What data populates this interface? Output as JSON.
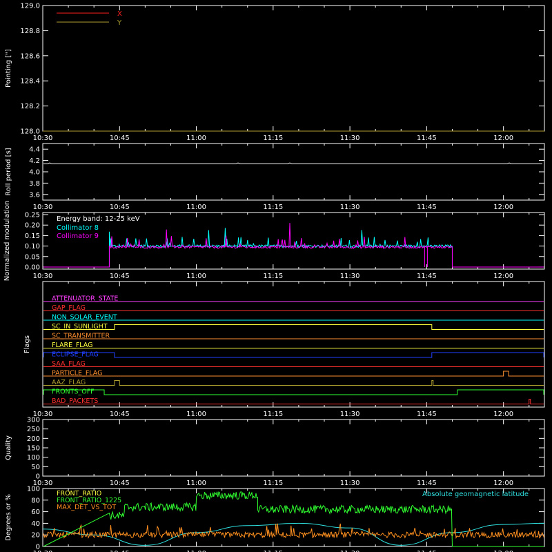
{
  "time_axis": {
    "tick_labels": [
      "10:30",
      "10:45",
      "11:00",
      "11:15",
      "11:30",
      "11:45",
      "12:00"
    ],
    "start_minutes": 630,
    "end_minutes": 728
  },
  "chart_data": [
    {
      "id": "pointing",
      "type": "line",
      "ylabel": "Pointing [\"]",
      "ylim": [
        128.0,
        129.0
      ],
      "y_ticks": [
        128.0,
        128.2,
        128.4,
        128.6,
        128.8,
        129.0
      ],
      "y_tick_labels": [
        "128.0",
        "128.2",
        "128.4",
        "128.6",
        "128.8",
        "129.0"
      ],
      "legend": [
        {
          "name": "X",
          "color": "#ff2020"
        },
        {
          "name": "Y",
          "color": "#b0a030"
        }
      ],
      "series": [
        {
          "name": "X",
          "color": "#ff2020",
          "x": [
            "10:30",
            "12:08"
          ],
          "values": [
            128.0,
            128.0
          ]
        },
        {
          "name": "Y",
          "color": "#b0a030",
          "x": [
            "10:30",
            "12:08"
          ],
          "values": [
            128.0,
            128.0
          ]
        }
      ]
    },
    {
      "id": "roll_period",
      "type": "line",
      "ylabel": "Roll period [s]",
      "ylim": [
        3.5,
        4.5
      ],
      "y_ticks": [
        3.6,
        3.8,
        4.0,
        4.2,
        4.4
      ],
      "y_tick_labels": [
        "3.6",
        "3.8",
        "4.0",
        "4.2",
        "4.4"
      ],
      "series": [
        {
          "name": "",
          "color": "#ffffff",
          "x": [
            "10:30",
            "12:08"
          ],
          "values": [
            4.14,
            4.14
          ]
        }
      ]
    },
    {
      "id": "modulation",
      "type": "line",
      "ylabel": "Normalized modulation",
      "ylim": [
        -0.01,
        0.26
      ],
      "y_ticks": [
        0.0,
        0.05,
        0.1,
        0.15,
        0.2,
        0.25
      ],
      "y_tick_labels": [
        "0.00",
        "0.05",
        "0.10",
        "0.15",
        "0.20",
        "0.25"
      ],
      "annotation": "Energy band: 12-25 keV",
      "legend": [
        {
          "name": "Collimator 8",
          "color": "#00ffff"
        },
        {
          "name": "Collimator 9",
          "color": "#ff00ff"
        }
      ],
      "active_range": [
        "10:43",
        "11:50"
      ],
      "series": [
        {
          "name": "Collimator 8",
          "color": "#00ffff",
          "baseline": 0.1,
          "spike_max": 0.23
        },
        {
          "name": "Collimator 9",
          "color": "#ff00ff",
          "baseline": 0.095,
          "spike_max": 0.25
        }
      ]
    },
    {
      "id": "flags",
      "type": "line",
      "ylabel": "Flags",
      "flags": [
        {
          "name": "ATTENUATOR_STATE",
          "color": "#ff40ff",
          "high_ranges": []
        },
        {
          "name": "GAP_FLAG",
          "color": "#ff3030",
          "high_ranges": []
        },
        {
          "name": "NON_SOLAR_EVENT",
          "color": "#00ffff",
          "high_ranges": []
        },
        {
          "name": "SC_IN_SUNLIGHT",
          "color": "#ffff40",
          "high_ranges": [
            [
              "10:44",
              "11:46"
            ]
          ]
        },
        {
          "name": "SC_TRANSMITTER",
          "color": "#ff9030",
          "high_ranges": []
        },
        {
          "name": "FLARE_FLAG",
          "color": "#ffff40",
          "high_ranges": []
        },
        {
          "name": "ECLIPSE_FLAG",
          "color": "#2040ff",
          "high_ranges": [
            [
              "10:30",
              "10:44"
            ],
            [
              "11:46",
              "12:08"
            ]
          ]
        },
        {
          "name": "SAA_FLAG",
          "color": "#ff3030",
          "high_ranges": []
        },
        {
          "name": "PARTICLE_FLAG",
          "color": "#ff9030",
          "high_ranges": [
            [
              "12:00",
              "12:01"
            ]
          ]
        },
        {
          "name": "AAZ_FLAG",
          "color": "#b0a030",
          "high_ranges": [
            [
              "10:44",
              "10:45"
            ],
            [
              "11:46",
              "11:46"
            ]
          ]
        },
        {
          "name": "FRONTS_OFF",
          "color": "#30ff30",
          "high_ranges": [
            [
              "10:30",
              "10:42"
            ],
            [
              "11:51",
              "12:08"
            ]
          ]
        },
        {
          "name": "BAD_PACKETS",
          "color": "#ff3030",
          "high_ranges": [
            [
              "12:05",
              "12:05"
            ]
          ]
        }
      ]
    },
    {
      "id": "quality",
      "type": "line",
      "ylabel": "Quality",
      "ylim": [
        0,
        300
      ],
      "y_ticks": [
        0,
        50,
        100,
        150,
        200,
        250,
        300
      ],
      "y_tick_labels": [
        "0",
        "50",
        "100",
        "150",
        "200",
        "250",
        "300"
      ],
      "series": []
    },
    {
      "id": "ratios",
      "type": "line",
      "ylabel": "Degrees or %",
      "ylim": [
        0,
        100
      ],
      "y_ticks": [
        0,
        20,
        40,
        60,
        80,
        100
      ],
      "y_tick_labels": [
        "0",
        "20",
        "40",
        "60",
        "80",
        "100"
      ],
      "legend": [
        {
          "name": "FRONT_RATIO",
          "color": "#ffff40"
        },
        {
          "name": "FRONT_RATIO_1225",
          "color": "#30ff30"
        },
        {
          "name": "MAX_DET_VS_TOT",
          "color": "#ff9020"
        }
      ],
      "right_label": {
        "text": "Absolute geomagnetic latitude",
        "color": "#30e0e0"
      },
      "series": [
        {
          "name": "FRONT_RATIO_1225",
          "color": "#30ff30",
          "segments": [
            {
              "x": [
                "10:43",
                "10:46"
              ],
              "level": 53
            },
            {
              "x": [
                "10:46",
                "11:00"
              ],
              "level": 68
            },
            {
              "x": [
                "11:00",
                "11:12"
              ],
              "level": 88
            },
            {
              "x": [
                "11:12",
                "11:50"
              ],
              "level": 64
            }
          ]
        },
        {
          "name": "MAX_DET_VS_TOT",
          "color": "#ff9020",
          "level": 20
        },
        {
          "name": "Absolute geomagnetic latitude",
          "color": "#30e0e0",
          "x": [
            "10:30",
            "10:40",
            "10:50",
            "11:00",
            "11:10",
            "11:20",
            "11:30",
            "11:40",
            "11:50",
            "12:00",
            "12:08"
          ],
          "values": [
            30,
            20,
            2,
            24,
            36,
            40,
            32,
            2,
            24,
            38,
            40
          ]
        }
      ]
    }
  ]
}
